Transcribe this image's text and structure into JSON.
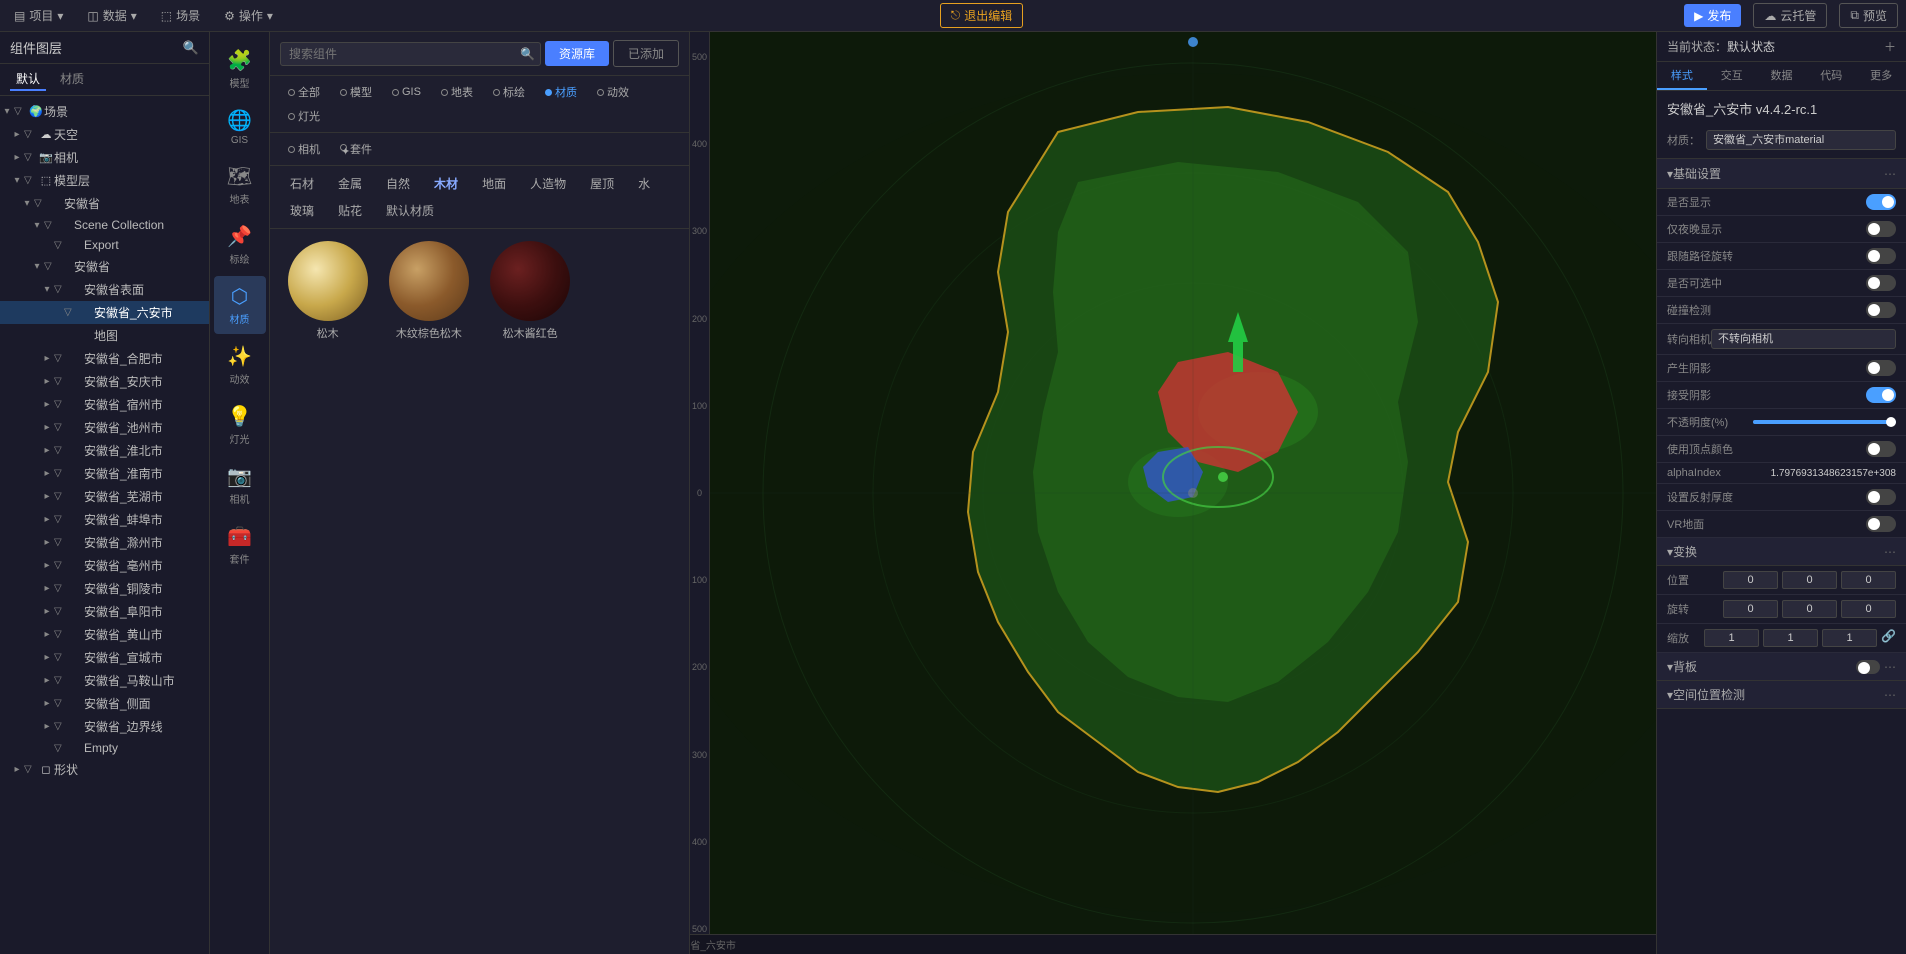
{
  "topbar": {
    "items": [
      {
        "label": "项目",
        "icon": "▤"
      },
      {
        "label": "数据",
        "icon": "◫"
      },
      {
        "label": "场景",
        "icon": "⬚"
      },
      {
        "label": "操作",
        "icon": "⚙"
      }
    ],
    "btn_publish": "发布",
    "btn_cloud": "云托管",
    "btn_preview": "预览",
    "btn_exit": "退出编辑"
  },
  "leftpanel": {
    "title": "组件图层",
    "tabs": [
      {
        "label": "默认",
        "active": true
      },
      {
        "label": "材质",
        "active": false
      }
    ],
    "tree": [
      {
        "id": 1,
        "indent": 0,
        "arrow": "▾",
        "check": "▽",
        "label": "场景",
        "icon": "🌍"
      },
      {
        "id": 2,
        "indent": 1,
        "arrow": "▸",
        "check": "▽",
        "label": "天空",
        "icon": "☁"
      },
      {
        "id": 3,
        "indent": 1,
        "arrow": "▸",
        "check": "▽",
        "label": "相机",
        "icon": "📷"
      },
      {
        "id": 4,
        "indent": 1,
        "arrow": "▾",
        "check": "▽",
        "label": "模型层",
        "icon": "⬚"
      },
      {
        "id": 5,
        "indent": 2,
        "arrow": "▾",
        "check": "▽",
        "label": "安徽省",
        "icon": ""
      },
      {
        "id": 6,
        "indent": 3,
        "arrow": "▾",
        "check": "▽",
        "label": "Scene Collection",
        "icon": ""
      },
      {
        "id": 7,
        "indent": 4,
        "arrow": "",
        "check": "▽",
        "label": "Export",
        "icon": ""
      },
      {
        "id": 8,
        "indent": 3,
        "arrow": "▾",
        "check": "▽",
        "label": "安徽省",
        "icon": ""
      },
      {
        "id": 9,
        "indent": 4,
        "arrow": "▾",
        "check": "▽",
        "label": "安徽省表面",
        "icon": ""
      },
      {
        "id": 10,
        "indent": 5,
        "arrow": "",
        "check": "▽",
        "label": "安徽省_六安市",
        "icon": "",
        "selected": true
      },
      {
        "id": 11,
        "indent": 5,
        "arrow": "",
        "check": "",
        "label": "地图",
        "icon": ""
      },
      {
        "id": 12,
        "indent": 4,
        "arrow": "▸",
        "check": "▽",
        "label": "安徽省_合肥市",
        "icon": ""
      },
      {
        "id": 13,
        "indent": 4,
        "arrow": "▸",
        "check": "▽",
        "label": "安徽省_安庆市",
        "icon": ""
      },
      {
        "id": 14,
        "indent": 4,
        "arrow": "▸",
        "check": "▽",
        "label": "安徽省_宿州市",
        "icon": ""
      },
      {
        "id": 15,
        "indent": 4,
        "arrow": "▸",
        "check": "▽",
        "label": "安徽省_池州市",
        "icon": ""
      },
      {
        "id": 16,
        "indent": 4,
        "arrow": "▸",
        "check": "▽",
        "label": "安徽省_淮北市",
        "icon": ""
      },
      {
        "id": 17,
        "indent": 4,
        "arrow": "▸",
        "check": "▽",
        "label": "安徽省_淮南市",
        "icon": ""
      },
      {
        "id": 18,
        "indent": 4,
        "arrow": "▸",
        "check": "▽",
        "label": "安徽省_芜湖市",
        "icon": ""
      },
      {
        "id": 19,
        "indent": 4,
        "arrow": "▸",
        "check": "▽",
        "label": "安徽省_蚌埠市",
        "icon": ""
      },
      {
        "id": 20,
        "indent": 4,
        "arrow": "▸",
        "check": "▽",
        "label": "安徽省_滁州市",
        "icon": ""
      },
      {
        "id": 21,
        "indent": 4,
        "arrow": "▸",
        "check": "▽",
        "label": "安徽省_亳州市",
        "icon": ""
      },
      {
        "id": 22,
        "indent": 4,
        "arrow": "▸",
        "check": "▽",
        "label": "安徽省_铜陵市",
        "icon": ""
      },
      {
        "id": 23,
        "indent": 4,
        "arrow": "▸",
        "check": "▽",
        "label": "安徽省_阜阳市",
        "icon": ""
      },
      {
        "id": 24,
        "indent": 4,
        "arrow": "▸",
        "check": "▽",
        "label": "安徽省_黄山市",
        "icon": ""
      },
      {
        "id": 25,
        "indent": 4,
        "arrow": "▸",
        "check": "▽",
        "label": "安徽省_宣城市",
        "icon": ""
      },
      {
        "id": 26,
        "indent": 4,
        "arrow": "▸",
        "check": "▽",
        "label": "安徽省_马鞍山市",
        "icon": ""
      },
      {
        "id": 27,
        "indent": 4,
        "arrow": "▸",
        "check": "▽",
        "label": "安徽省_侧面",
        "icon": ""
      },
      {
        "id": 28,
        "indent": 4,
        "arrow": "▸",
        "check": "▽",
        "label": "安徽省_边界线",
        "icon": ""
      },
      {
        "id": 29,
        "indent": 4,
        "arrow": "",
        "check": "▽",
        "label": "Empty",
        "icon": ""
      },
      {
        "id": 30,
        "indent": 1,
        "arrow": "▸",
        "check": "▽",
        "label": "形状",
        "icon": "◻"
      }
    ]
  },
  "iconbar": {
    "items": [
      {
        "icon": "🧩",
        "label": "模型",
        "active": false
      },
      {
        "icon": "🌍",
        "label": "GIS",
        "active": false
      },
      {
        "icon": "🗺",
        "label": "地表",
        "active": false
      },
      {
        "icon": "📌",
        "label": "标绘",
        "active": false
      },
      {
        "icon": "⬡",
        "label": "材质",
        "active": true
      },
      {
        "icon": "✨",
        "label": "动效",
        "active": false
      },
      {
        "icon": "💡",
        "label": "灯光",
        "active": false
      },
      {
        "icon": "📷",
        "label": "相机",
        "active": false
      },
      {
        "icon": "🧰",
        "label": "套件",
        "active": false
      }
    ]
  },
  "component_panel": {
    "search_placeholder": "搜索组件",
    "tabs": [
      {
        "label": "资源库",
        "active": true
      },
      {
        "label": "已添加",
        "active": false
      }
    ],
    "filters": [
      {
        "label": "全部",
        "active": false
      },
      {
        "label": "模型",
        "active": false
      },
      {
        "label": "GIS",
        "active": false
      },
      {
        "label": "地表",
        "active": false
      },
      {
        "label": "标绘",
        "active": false
      },
      {
        "label": "材质",
        "active": true
      },
      {
        "label": "动效",
        "active": false
      },
      {
        "label": "灯光",
        "active": false
      }
    ],
    "subfilters": [
      {
        "label": "相机",
        "active": false
      },
      {
        "label": "套件",
        "active": false
      }
    ],
    "categories": [
      {
        "label": "石材",
        "active": false
      },
      {
        "label": "金属",
        "active": false
      },
      {
        "label": "自然",
        "active": false
      },
      {
        "label": "木材",
        "active": true
      },
      {
        "label": "地面",
        "active": false
      },
      {
        "label": "人造物",
        "active": false
      },
      {
        "label": "屋顶",
        "active": false
      },
      {
        "label": "水",
        "active": false
      },
      {
        "label": "玻璃",
        "active": false
      },
      {
        "label": "贴花",
        "active": false
      },
      {
        "label": "默认材质",
        "active": false
      }
    ],
    "materials": [
      {
        "name": "松木",
        "type": "pine"
      },
      {
        "name": "木纹棕色松木",
        "type": "wood"
      },
      {
        "name": "松木酱红色",
        "type": "mahogany"
      }
    ]
  },
  "rightpanel": {
    "status_prefix": "当前状态：",
    "status_value": "默认状态",
    "tabs": [
      "样式",
      "交互",
      "数据",
      "代码",
      "更多"
    ],
    "component_name": "安徽省_六安市 v4.4.2-rc.1",
    "material_label": "材质：",
    "material_value": "安徽省_六安市material",
    "sections": {
      "basic": {
        "title": "基础设置",
        "props": [
          {
            "label": "是否显示",
            "type": "toggle",
            "value": true
          },
          {
            "label": "仅夜晚显示",
            "type": "toggle",
            "value": false
          },
          {
            "label": "跟随路径旋转",
            "type": "toggle",
            "value": false
          },
          {
            "label": "是否可选中",
            "type": "toggle",
            "value": false
          },
          {
            "label": "碰撞检测",
            "type": "toggle",
            "value": false
          },
          {
            "label": "转向相机",
            "type": "select",
            "value": "不转向相机"
          },
          {
            "label": "产生阴影",
            "type": "toggle",
            "value": false
          },
          {
            "label": "接受阴影",
            "type": "toggle",
            "value": true
          }
        ]
      },
      "opacity": {
        "label": "不透明度(%)",
        "value": 100
      },
      "vertex_color": {
        "label": "使用顶点颜色",
        "type": "toggle",
        "value": false
      },
      "alpha_index": {
        "label": "alphaIndex",
        "value": "1.7976931348623157e+308"
      },
      "reflection": {
        "label": "设置反射厚度",
        "type": "toggle",
        "value": false
      },
      "vr": {
        "label": "VR地面",
        "type": "toggle",
        "value": false
      },
      "transform": {
        "title": "变换",
        "position": {
          "label": "位置",
          "x": "0",
          "y": "0",
          "z": "0"
        },
        "rotation": {
          "label": "旋转",
          "x": "0",
          "y": "0",
          "z": "0"
        },
        "scale": {
          "label": "缩放",
          "x": "1",
          "y": "1",
          "z": "1"
        }
      },
      "backplate": {
        "title": "背板",
        "type": "toggle",
        "value": false
      },
      "spatial": {
        "title": "空间位置检测"
      }
    }
  },
  "statusbar": {
    "text": "当前近中: 空场景 > 场景 > 模型层 > 安徽省 > Scene Collection > 安徽省 > 安徽省表面 > 安徽省_六安市"
  },
  "scale_numbers": [
    "-500",
    "-400",
    "-300",
    "-200",
    "-100",
    "0",
    "100",
    "200",
    "300",
    "400",
    "500"
  ]
}
